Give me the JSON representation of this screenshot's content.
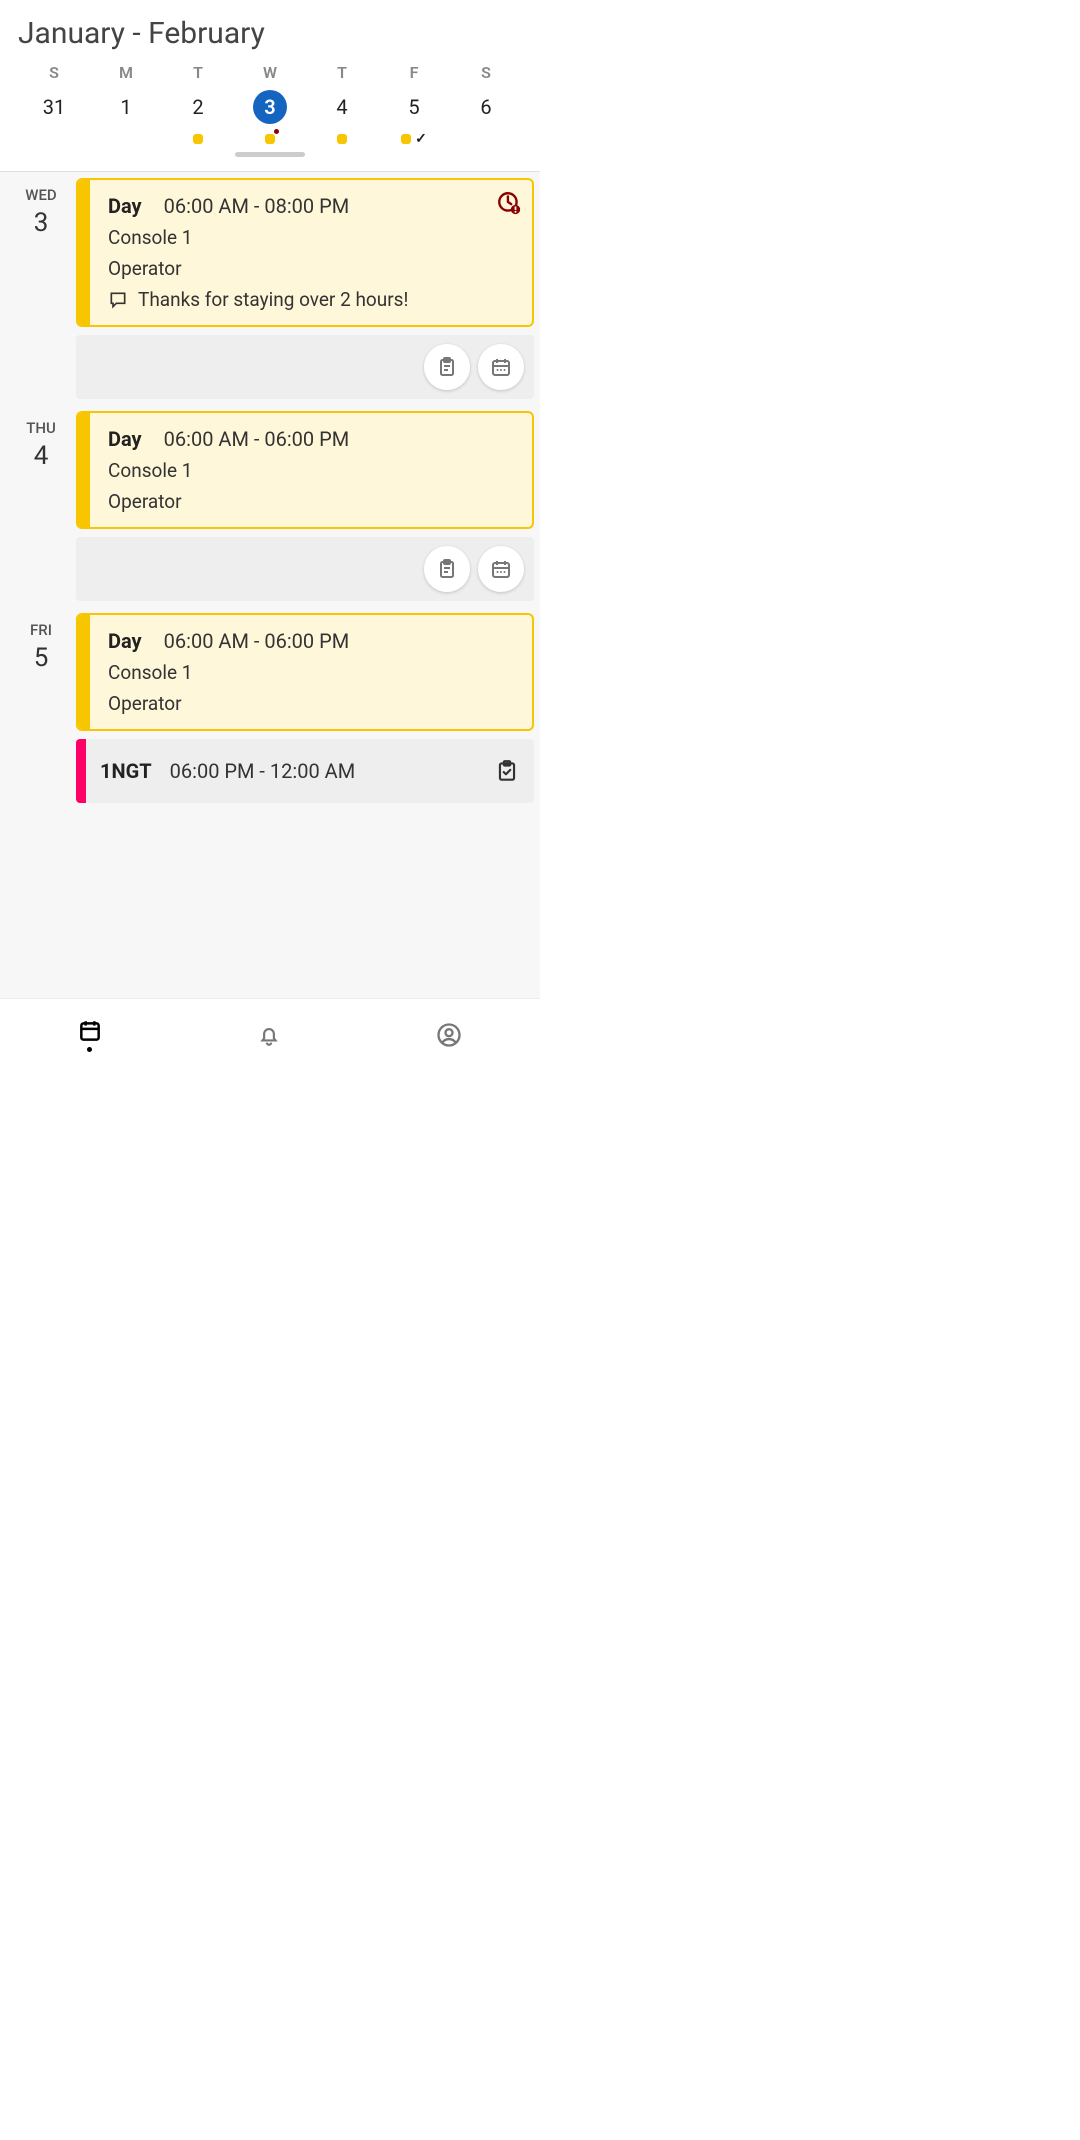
{
  "header": {
    "title": "January - February"
  },
  "week": {
    "dows": [
      "S",
      "M",
      "T",
      "W",
      "T",
      "F",
      "S"
    ],
    "days": [
      {
        "num": "31",
        "dot": false,
        "check": false,
        "red": false,
        "selected": false
      },
      {
        "num": "1",
        "dot": false,
        "check": false,
        "red": false,
        "selected": false
      },
      {
        "num": "2",
        "dot": true,
        "check": false,
        "red": false,
        "selected": false
      },
      {
        "num": "3",
        "dot": true,
        "check": false,
        "red": true,
        "selected": true
      },
      {
        "num": "4",
        "dot": true,
        "check": false,
        "red": false,
        "selected": false
      },
      {
        "num": "5",
        "dot": true,
        "check": true,
        "red": false,
        "selected": false
      },
      {
        "num": "6",
        "dot": false,
        "check": false,
        "red": false,
        "selected": false
      }
    ]
  },
  "days": [
    {
      "dw": "WED",
      "dn": "3",
      "card": {
        "name": "Day",
        "time": "06:00 AM - 08:00 PM",
        "location": "Console 1",
        "role": "Operator",
        "comment": "Thanks for staying over 2 hours!",
        "alert": true
      }
    },
    {
      "dw": "THU",
      "dn": "4",
      "card": {
        "name": "Day",
        "time": "06:00 AM - 06:00 PM",
        "location": "Console 1",
        "role": "Operator",
        "comment": "",
        "alert": false
      }
    },
    {
      "dw": "FRI",
      "dn": "5",
      "card": {
        "name": "Day",
        "time": "06:00 AM - 06:00 PM",
        "location": "Console 1",
        "role": "Operator",
        "comment": "",
        "alert": false
      },
      "card2": {
        "name": "1NGT",
        "time": "06:00 PM - 12:00 AM"
      }
    }
  ]
}
